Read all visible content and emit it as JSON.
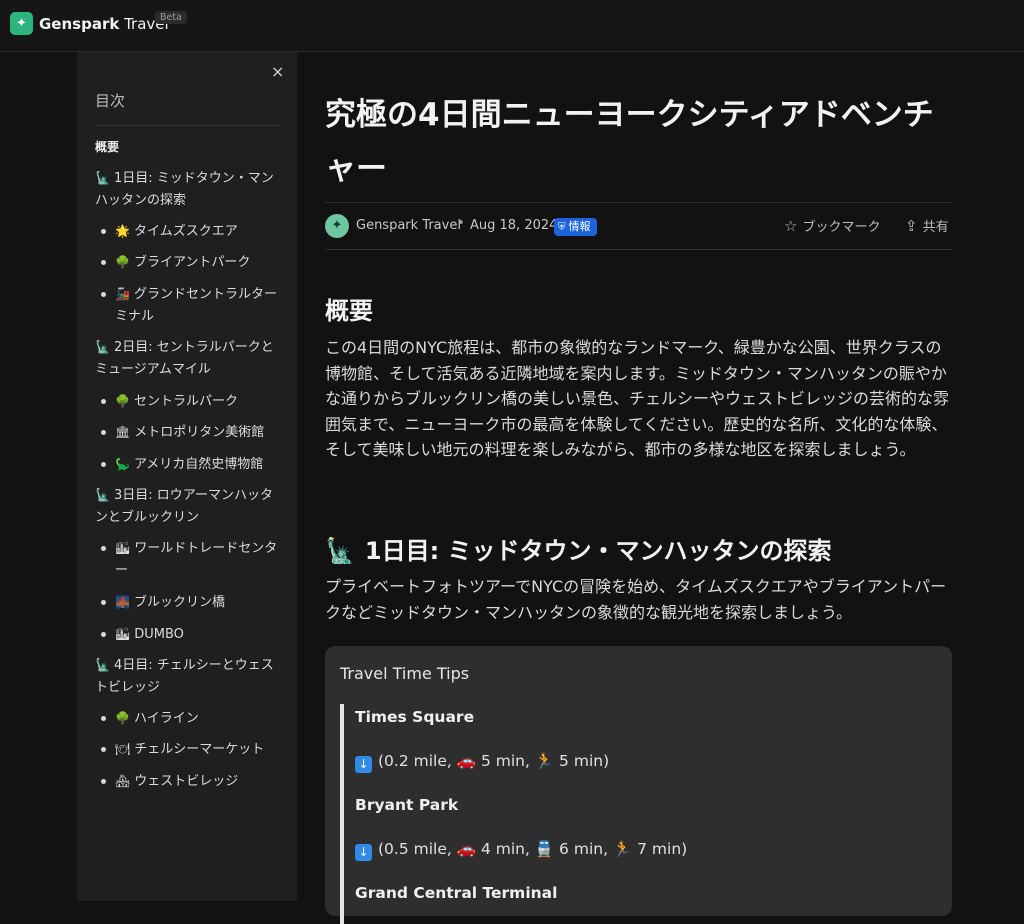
{
  "app": {
    "brand_bold": "Genspark",
    "brand_rest": " Travel",
    "badge": "Beta"
  },
  "sidebar": {
    "title": "目次",
    "close_glyph": "×",
    "items": [
      {
        "kind": "section",
        "text": "概要"
      },
      {
        "kind": "day",
        "emoji": "🗽",
        "text": "1日目: ミッドタウン・マンハッタンの探索"
      },
      {
        "kind": "sub",
        "emoji": "🌟",
        "text": "タイムズスクエア"
      },
      {
        "kind": "sub",
        "emoji": "🌳",
        "text": "ブライアントパーク"
      },
      {
        "kind": "sub",
        "emoji": "🚂",
        "text": "グランドセントラルターミナル"
      },
      {
        "kind": "day",
        "emoji": "🗽",
        "text": "2日目: セントラルパークとミュージアムマイル"
      },
      {
        "kind": "sub",
        "emoji": "🌳",
        "text": "セントラルパーク"
      },
      {
        "kind": "sub",
        "emoji": "🏛",
        "text": "メトロポリタン美術館"
      },
      {
        "kind": "sub",
        "emoji": "🦕",
        "text": "アメリカ自然史博物館"
      },
      {
        "kind": "day",
        "emoji": "🗽",
        "text": "3日目: ロウアーマンハッタンとブルックリン"
      },
      {
        "kind": "sub",
        "emoji": "🏙",
        "text": "ワールドトレードセンター"
      },
      {
        "kind": "sub",
        "emoji": "🌉",
        "text": "ブルックリン橋"
      },
      {
        "kind": "sub",
        "emoji": "🏙",
        "text": "DUMBO"
      },
      {
        "kind": "day",
        "emoji": "🗽",
        "text": "4日目: チェルシーとウェストビレッジ"
      },
      {
        "kind": "sub",
        "emoji": "🌳",
        "text": "ハイライン"
      },
      {
        "kind": "sub",
        "emoji": "🍽",
        "text": "チェルシーマーケット"
      },
      {
        "kind": "sub",
        "emoji": "🏘",
        "text": "ウェストビレッジ"
      }
    ]
  },
  "article": {
    "title": "究極の4日間ニューヨークシティアドベンチャー",
    "author": "Genspark Travel",
    "separator": "•",
    "date": "Aug 18, 2024",
    "badge": "情報",
    "bookmark": "ブックマーク",
    "share": "共有",
    "overview_heading": "概要",
    "overview_text": "この4日間のNYC旅程は、都市の象徴的なランドマーク、緑豊かな公園、世界クラスの博物館、そして活気ある近隣地域を案内します。ミッドタウン・マンハッタンの賑やかな通りからブルックリン橋の美しい景色、チェルシーやウェストビレッジの芸術的な雰囲気まで、ニューヨーク市の最高を体験してください。歴史的な名所、文化的な体験、そして美味しい地元の料理を楽しみながら、都市の多様な地区を探索しましょう。",
    "day1_emoji": "🗽",
    "day1_heading": "1日目: ミッドタウン・マンハッタンの探索",
    "day1_text": "プライベートフォトツアーでNYCの冒険を始め、タイムズスクエアやブライアントパークなどミッドタウン・マンハッタンの象徴的な観光地を探索しましょう。"
  },
  "tips": {
    "title": "Travel Time Tips",
    "stops": [
      {
        "name": "Times Square",
        "line": "(0.2 mile, 🚗 5 min, 🏃 5 min)"
      },
      {
        "name": "Bryant Park",
        "line": "(0.5 mile, 🚗 4 min, 🚆 6 min, 🏃 7 min)"
      },
      {
        "name": "Grand Central Terminal",
        "line": ""
      }
    ]
  },
  "colors": {
    "accent_green": "#2db37d",
    "badge_blue": "#1b63d8",
    "arrow_blue": "#2f8be6"
  }
}
